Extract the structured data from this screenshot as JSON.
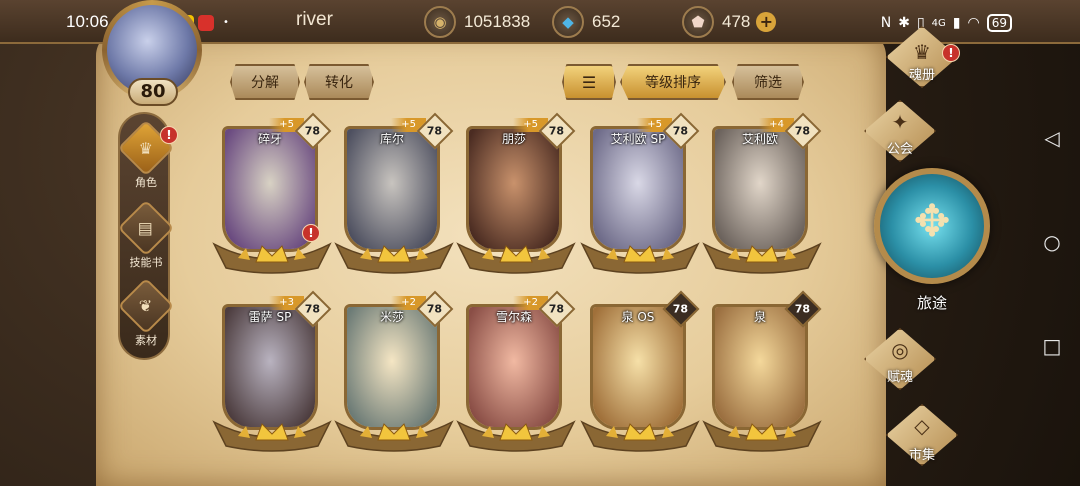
{
  "status_bar": {
    "time": "10:06",
    "battery": "69",
    "network": "4G"
  },
  "player": {
    "name": "river",
    "level": "80"
  },
  "resources": [
    {
      "icon": "coin-icon",
      "value": "1051838"
    },
    {
      "icon": "crystal-icon",
      "value": "652"
    },
    {
      "icon": "gem-icon",
      "value": "478"
    }
  ],
  "toolbar": {
    "decompose": "分解",
    "convert": "转化",
    "sort": "等级排序",
    "filter": "筛选"
  },
  "left_nav": [
    {
      "label": "角色",
      "active": true,
      "alert": "!"
    },
    {
      "label": "技能书",
      "active": false,
      "alert": ""
    },
    {
      "label": "素材",
      "active": false,
      "alert": ""
    }
  ],
  "cards": [
    {
      "name": "碎牙",
      "level": "78",
      "plus": "+5",
      "alert": "!",
      "colors": [
        "#d8d2c4",
        "#6a4a80"
      ]
    },
    {
      "name": "库尔",
      "level": "78",
      "plus": "+5",
      "alert": "",
      "colors": [
        "#c8c4bf",
        "#4e5060"
      ]
    },
    {
      "name": "朋莎",
      "level": "78",
      "plus": "+5",
      "alert": "",
      "colors": [
        "#c9926c",
        "#4b2c22"
      ]
    },
    {
      "name": "艾利欧 SP",
      "level": "78",
      "plus": "+5",
      "alert": "",
      "colors": [
        "#d9d8e6",
        "#6d6a88"
      ]
    },
    {
      "name": "艾利欧",
      "level": "78",
      "plus": "+4",
      "alert": "",
      "colors": [
        "#e1d6c9",
        "#6b625c"
      ]
    },
    {
      "name": "雷萨 SP",
      "level": "78",
      "plus": "+3",
      "alert": "",
      "colors": [
        "#b9b3c0",
        "#4d3d3f"
      ]
    },
    {
      "name": "米莎",
      "level": "78",
      "plus": "+2",
      "alert": "",
      "colors": [
        "#f5e6c4",
        "#6c7b76"
      ]
    },
    {
      "name": "雪尔森",
      "level": "78",
      "plus": "+2",
      "alert": "",
      "colors": [
        "#f1b9a2",
        "#8a4e46"
      ]
    },
    {
      "name": "泉 OS",
      "level": "78",
      "plus": "",
      "alert": "",
      "colors": [
        "#f6e0a8",
        "#a0703a"
      ]
    },
    {
      "name": "泉",
      "level": "78",
      "plus": "",
      "alert": "",
      "colors": [
        "#f4d89b",
        "#9b6f40"
      ]
    }
  ],
  "right_nav": {
    "soul_book": "魂册",
    "soul_book_alert": "!",
    "guild": "公会",
    "journey": "旅途",
    "bestow": "赋魂",
    "market": "市集"
  }
}
